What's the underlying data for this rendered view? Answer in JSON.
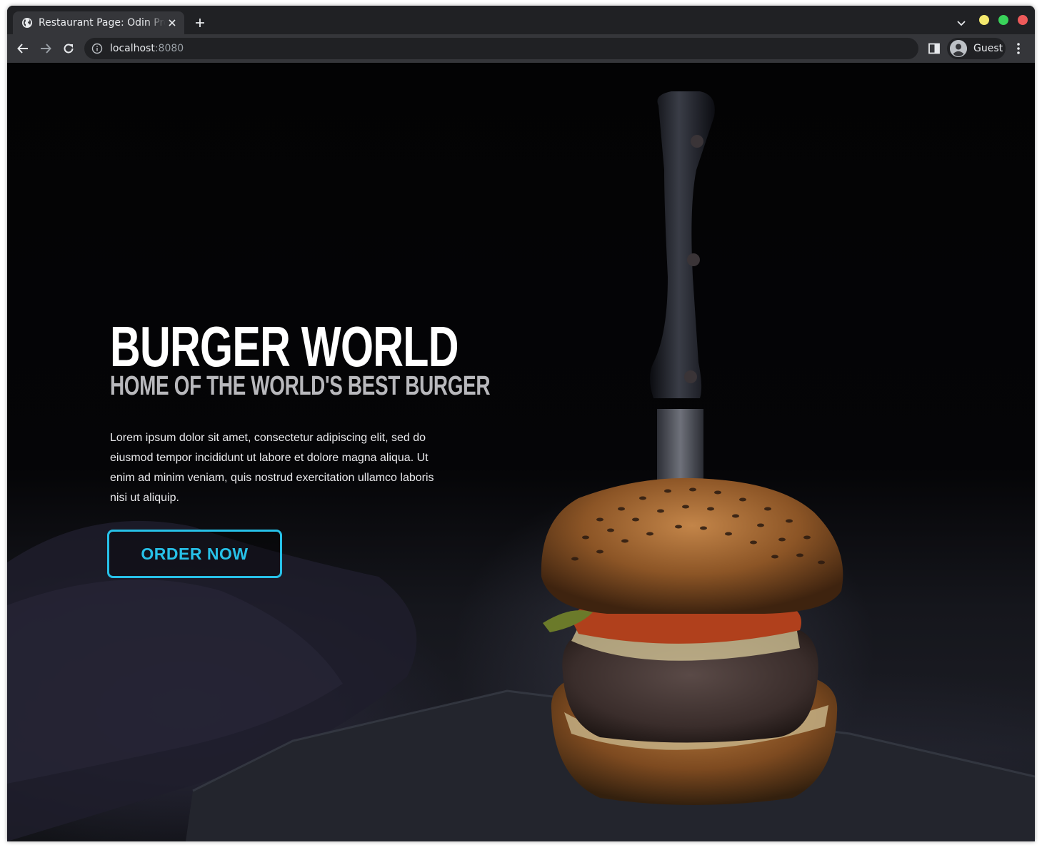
{
  "browser": {
    "tab_title": "Restaurant Page: Odin Project",
    "url_host": "localhost",
    "url_port": ":8080",
    "profile_name": "Guest"
  },
  "hero": {
    "title": "BURGER WORLD",
    "subtitle": "HOME OF THE WORLD'S BEST BURGER",
    "description": "Lorem ipsum dolor sit amet, consectetur adipiscing elit, sed do eiusmod tempor incididunt ut labore et dolore magna aliqua. Ut enim ad minim veniam, quis nostrud exercitation ullamco laboris nisi ut aliquip.",
    "cta_label": "ORDER NOW"
  },
  "colors": {
    "accent": "#27c1e8",
    "title": "#ffffff",
    "subtitle": "#b8b8bc",
    "background": "#050507"
  },
  "icons": {
    "favicon": "globe-icon",
    "back": "arrow-left-icon",
    "forward": "arrow-right-icon",
    "reload": "reload-icon",
    "site_info": "info-icon",
    "side_panel": "side-panel-icon",
    "profile": "avatar-icon",
    "menu": "kebab-menu-icon"
  }
}
